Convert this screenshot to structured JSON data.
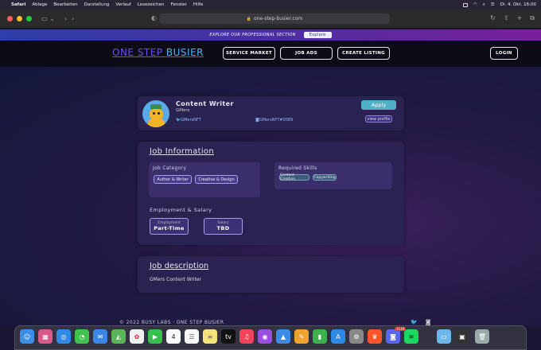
{
  "menubar": {
    "app": "Safari",
    "items": [
      "Ablage",
      "Bearbeiten",
      "Darstellung",
      "Verlauf",
      "Lesezeichen",
      "Fenster",
      "Hilfe"
    ],
    "datetime": "Di. 4. Okt.  16:00"
  },
  "browser": {
    "url": "one-step-busier.com"
  },
  "promo": {
    "text": "EXPLORE OUR PROFESSIONAL SECTION",
    "button": "Explore"
  },
  "header": {
    "logo_part1": "ONE STEP ",
    "logo_part2": "BUSIER",
    "nav": [
      "SERVICE MARKET",
      "JOB ADS",
      "CREATE LISTING"
    ],
    "login": "LOGIN"
  },
  "job": {
    "title": "Content Writer",
    "company": "GMers",
    "twitter": "GMersNFT",
    "discord": "GMersNFT#0089",
    "apply_label": "Apply",
    "view_profile_label": "view profile"
  },
  "job_info": {
    "heading": "Job Information",
    "category_label": "Job Category",
    "categories": [
      "Author & Writer",
      "Creative & Design"
    ],
    "skills_label": "Required Skills",
    "skills": [
      "Content Creation",
      "Copywriting"
    ],
    "employment_label": "Employment & Salary",
    "employment_key": "Employment",
    "employment_value": "Part-Time",
    "salary_key": "Salary",
    "salary_value": "TBD"
  },
  "description": {
    "heading": "Job description",
    "text": "GMers Content Writer"
  },
  "footer": {
    "text": "© 2022 BUSY LABS · ONE STEP BUSIER"
  },
  "dock": {
    "icons": [
      "finder-icon",
      "launchpad-icon",
      "safari-icon",
      "messages-icon",
      "mail-icon",
      "maps-icon",
      "photos-icon",
      "facetime-icon",
      "calendar-icon",
      "reminders-icon",
      "notes-icon",
      "appletv-icon",
      "music-icon",
      "podcasts-icon",
      "keynote-icon",
      "pages-icon",
      "numbers-icon",
      "appstore-icon",
      "settings-icon",
      "brave-icon",
      "discord-icon",
      "spotify-icon",
      "folder-icon",
      "screenshot-icon",
      "trash-icon"
    ],
    "calendar_day": "4",
    "discord_badge": "1119"
  }
}
